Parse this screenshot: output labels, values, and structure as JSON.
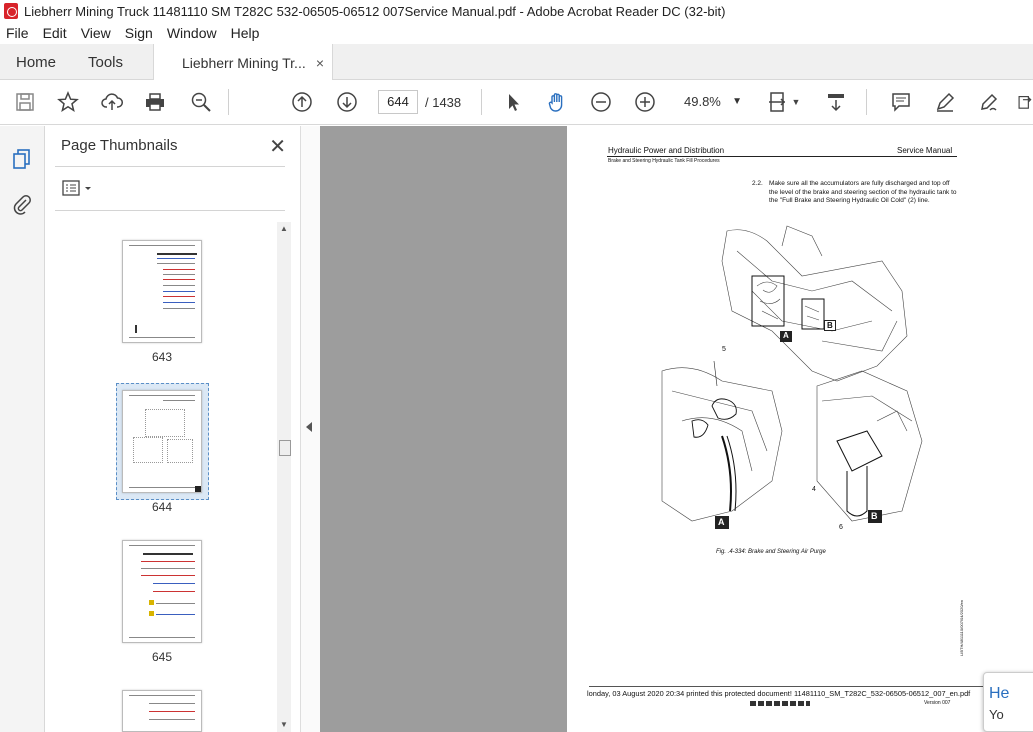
{
  "window": {
    "title": "Liebherr Mining Truck 11481110 SM T282C 532-06505-06512 007Service Manual.pdf - Adobe Acrobat Reader DC (32-bit)"
  },
  "menu": [
    "File",
    "Edit",
    "View",
    "Sign",
    "Window",
    "Help"
  ],
  "tabs": {
    "home": "Home",
    "tools": "Tools",
    "document": "Liebherr Mining Tr...",
    "close": "×"
  },
  "toolbar": {
    "page_current": "644",
    "page_total": "/ 1438",
    "zoom": "49.8%"
  },
  "panel": {
    "title": "Page Thumbnails",
    "close": "✕",
    "thumbnails": [
      {
        "label": "643",
        "selected": false
      },
      {
        "label": "644",
        "selected": true
      },
      {
        "label": "645",
        "selected": false
      }
    ]
  },
  "document_page": {
    "header_left": "Hydraulic Power and Distribution",
    "header_right": "Service Manual",
    "subheader": "Brake and Steering Hydraulic Tank Fill Procedures",
    "step_number": "2.2.",
    "step_text": "Make sure all the accumulators are fully discharged and top off the level of the brake and steering section of the hydraulic tank to the \"Full Brake and Steering Hydraulic Oil Cold\" (2) line.",
    "callout_a": "A",
    "callout_b": "B",
    "callout_5": "5",
    "callout_4": "4",
    "callout_6": "6",
    "figure_caption": "Fig. .4-334: Brake and Steering Air Purge",
    "footer_watermark": "londay, 03 August 2020 20:34 printed this protected document! 11481110_SM_T282C_532-06505-06512_007_en.pdf",
    "footer_version": "Version 007",
    "side_code": "LIBTH/4811110/007/04/2020/en"
  },
  "help_bubble": {
    "line1": "He",
    "line2": "Yo"
  },
  "colors": {
    "accent": "#2a6fbf",
    "adobe_red": "#d8232a",
    "doc_bg": "#9d9d9d"
  }
}
